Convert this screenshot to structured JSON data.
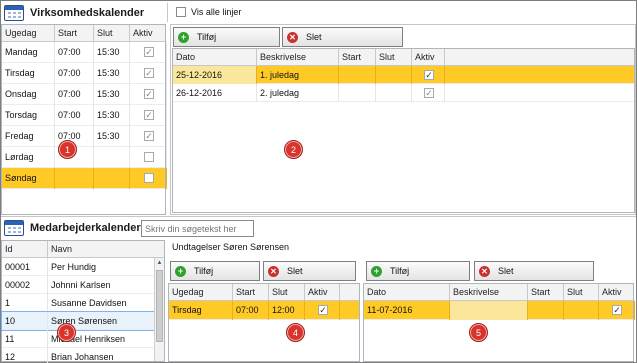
{
  "company_calendar": {
    "title": "Virksomhedskalender",
    "show_all_label": "Vis alle linjer",
    "show_all_checked": false,
    "weekday_columns": [
      "Ugedag",
      "Start",
      "Slut",
      "Aktiv"
    ],
    "weekdays": [
      {
        "day": "Mandag",
        "start": "07:00",
        "end": "15:30",
        "active": true,
        "selected": false
      },
      {
        "day": "Tirsdag",
        "start": "07:00",
        "end": "15:30",
        "active": true,
        "selected": false
      },
      {
        "day": "Onsdag",
        "start": "07:00",
        "end": "15:30",
        "active": true,
        "selected": false
      },
      {
        "day": "Torsdag",
        "start": "07:00",
        "end": "15:30",
        "active": true,
        "selected": false
      },
      {
        "day": "Fredag",
        "start": "07:00",
        "end": "15:30",
        "active": true,
        "selected": false
      },
      {
        "day": "Lørdag",
        "start": "",
        "end": "",
        "active": false,
        "selected": false
      },
      {
        "day": "Søndag",
        "start": "",
        "end": "",
        "active": false,
        "selected": true
      }
    ],
    "add_label": "Tilføj",
    "delete_label": "Slet",
    "date_columns": [
      "Dato",
      "Beskrivelse",
      "Start",
      "Slut",
      "Aktiv"
    ],
    "dates": [
      {
        "date": "25-12-2016",
        "description": "1. juledag",
        "start": "",
        "end": "",
        "active": true,
        "selected": true
      },
      {
        "date": "26-12-2016",
        "description": "2. juledag",
        "start": "",
        "end": "",
        "active": true,
        "selected": false
      }
    ]
  },
  "employee_calendar": {
    "title": "Medarbejderkalender",
    "search_placeholder": "Skriv din søgetekst her",
    "employee_columns": [
      "Id",
      "Navn"
    ],
    "employees": [
      {
        "id": "00001",
        "name": "Per Hundig",
        "selected": false
      },
      {
        "id": "00002",
        "name": "Johnni Karlsen",
        "selected": false
      },
      {
        "id": "1",
        "name": "Susanne Davidsen",
        "selected": false
      },
      {
        "id": "10",
        "name": "Søren Sørensen",
        "selected": true
      },
      {
        "id": "11",
        "name": "Michael Henriksen",
        "selected": false
      },
      {
        "id": "12",
        "name": "Brian Johansen",
        "selected": false
      }
    ],
    "exceptions_label": "Undtagelser Søren Sørensen",
    "add_label": "Tilføj",
    "delete_label": "Slet",
    "weekday_columns": [
      "Ugedag",
      "Start",
      "Slut",
      "Aktiv"
    ],
    "weekdays": [
      {
        "day": "Tirsdag",
        "start": "07:00",
        "end": "12:00",
        "active": true,
        "selected": true
      }
    ],
    "date_columns": [
      "Dato",
      "Beskrivelse",
      "Start",
      "Slut",
      "Aktiv"
    ],
    "dates": [
      {
        "date": "11-07-2016",
        "description": "",
        "start": "",
        "end": "",
        "active": true,
        "selected": true
      }
    ]
  },
  "callouts": [
    "1",
    "2",
    "3",
    "4",
    "5"
  ],
  "colors": {
    "selection": "#ffc926",
    "callout": "#d9342b",
    "add_icon": "#2fa12c",
    "delete_icon": "#c8322e",
    "calendar_icon": "#2b62b5"
  },
  "icons": {
    "calendar": "calendar-icon",
    "add": "plus-circle-icon",
    "delete": "x-circle-icon",
    "checkbox": "check-icon"
  }
}
